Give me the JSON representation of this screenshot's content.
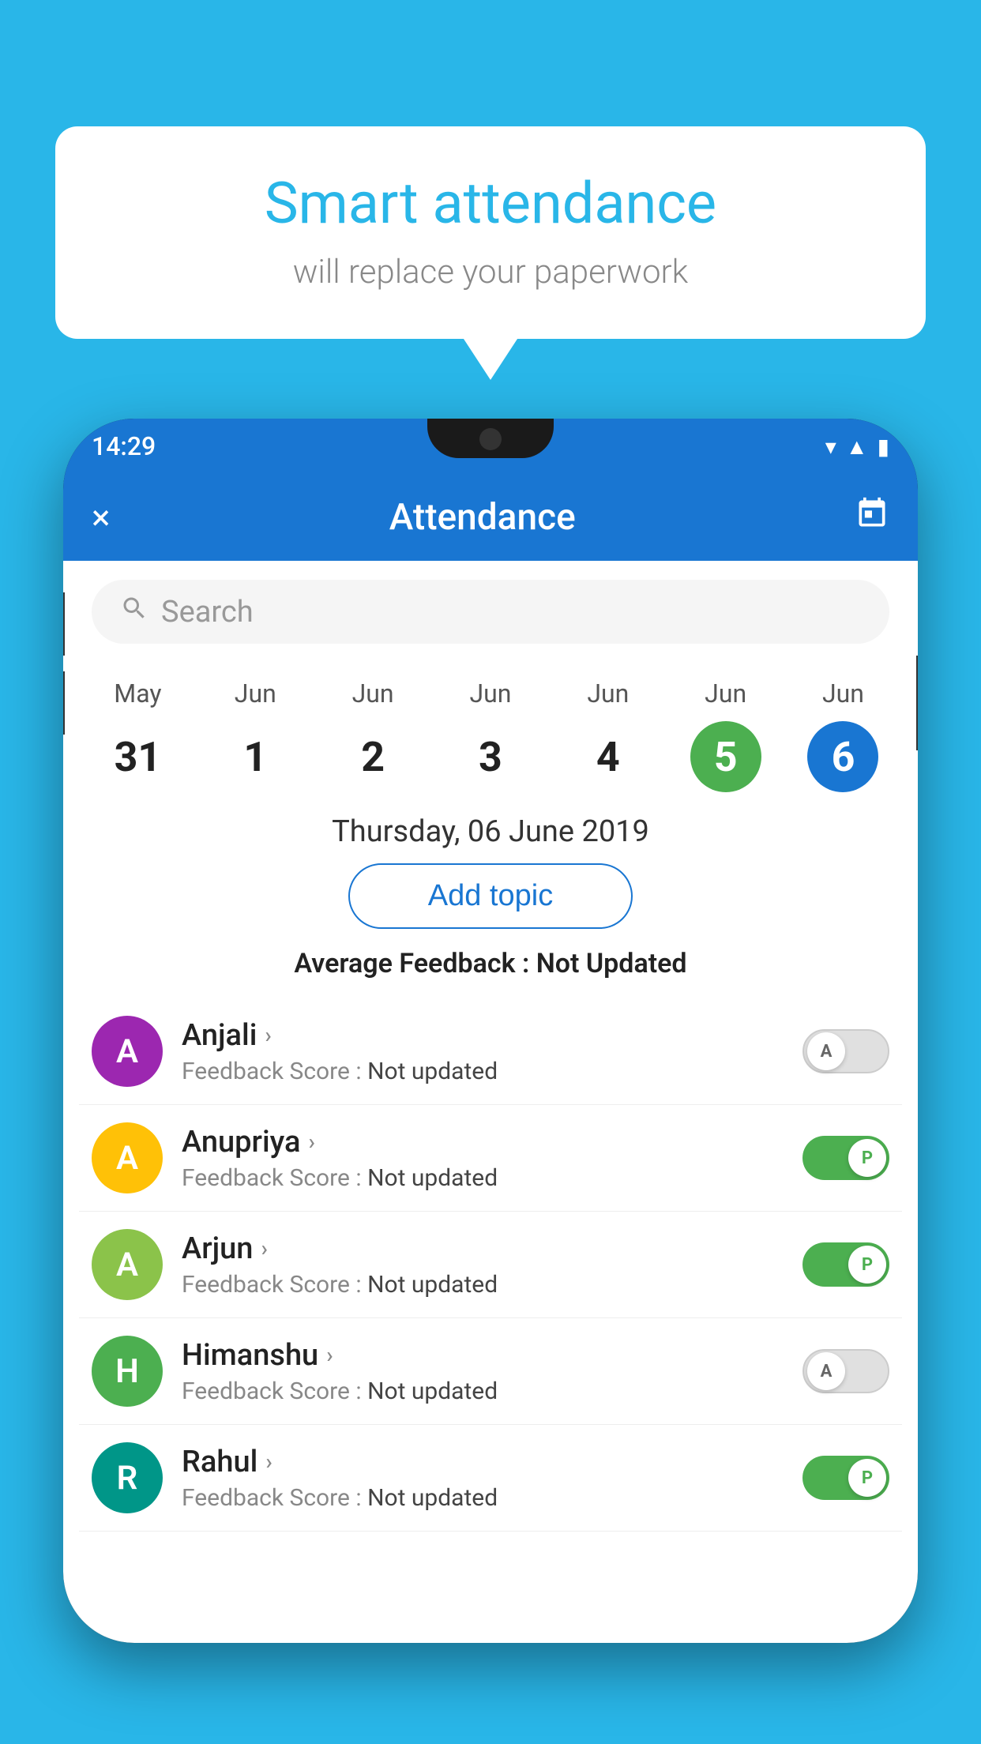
{
  "background_color": "#29b6e8",
  "bubble": {
    "title": "Smart attendance",
    "subtitle": "will replace your paperwork"
  },
  "phone": {
    "status_bar": {
      "time": "14:29",
      "icons": [
        "wifi",
        "signal",
        "battery"
      ]
    },
    "app_bar": {
      "title": "Attendance",
      "close_label": "×",
      "calendar_icon": "📅"
    },
    "search": {
      "placeholder": "Search"
    },
    "dates": [
      {
        "month": "May",
        "day": "31",
        "state": "normal"
      },
      {
        "month": "Jun",
        "day": "1",
        "state": "normal"
      },
      {
        "month": "Jun",
        "day": "2",
        "state": "normal"
      },
      {
        "month": "Jun",
        "day": "3",
        "state": "normal"
      },
      {
        "month": "Jun",
        "day": "4",
        "state": "normal"
      },
      {
        "month": "Jun",
        "day": "5",
        "state": "today"
      },
      {
        "month": "Jun",
        "day": "6",
        "state": "selected"
      }
    ],
    "selected_date": "Thursday, 06 June 2019",
    "add_topic_label": "Add topic",
    "avg_feedback_label": "Average Feedback :",
    "avg_feedback_value": "Not Updated",
    "students": [
      {
        "name": "Anjali",
        "avatar_letter": "A",
        "avatar_color": "purple",
        "feedback": "Feedback Score : Not updated",
        "toggle_state": "off",
        "toggle_label": "A"
      },
      {
        "name": "Anupriya",
        "avatar_letter": "A",
        "avatar_color": "yellow",
        "feedback": "Feedback Score : Not updated",
        "toggle_state": "on",
        "toggle_label": "P"
      },
      {
        "name": "Arjun",
        "avatar_letter": "A",
        "avatar_color": "light-green",
        "feedback": "Feedback Score : Not updated",
        "toggle_state": "on",
        "toggle_label": "P"
      },
      {
        "name": "Himanshu",
        "avatar_letter": "H",
        "avatar_color": "green",
        "feedback": "Feedback Score : Not updated",
        "toggle_state": "off",
        "toggle_label": "A"
      },
      {
        "name": "Rahul",
        "avatar_letter": "R",
        "avatar_color": "teal",
        "feedback": "Feedback Score : Not updated",
        "toggle_state": "on",
        "toggle_label": "P"
      }
    ]
  }
}
